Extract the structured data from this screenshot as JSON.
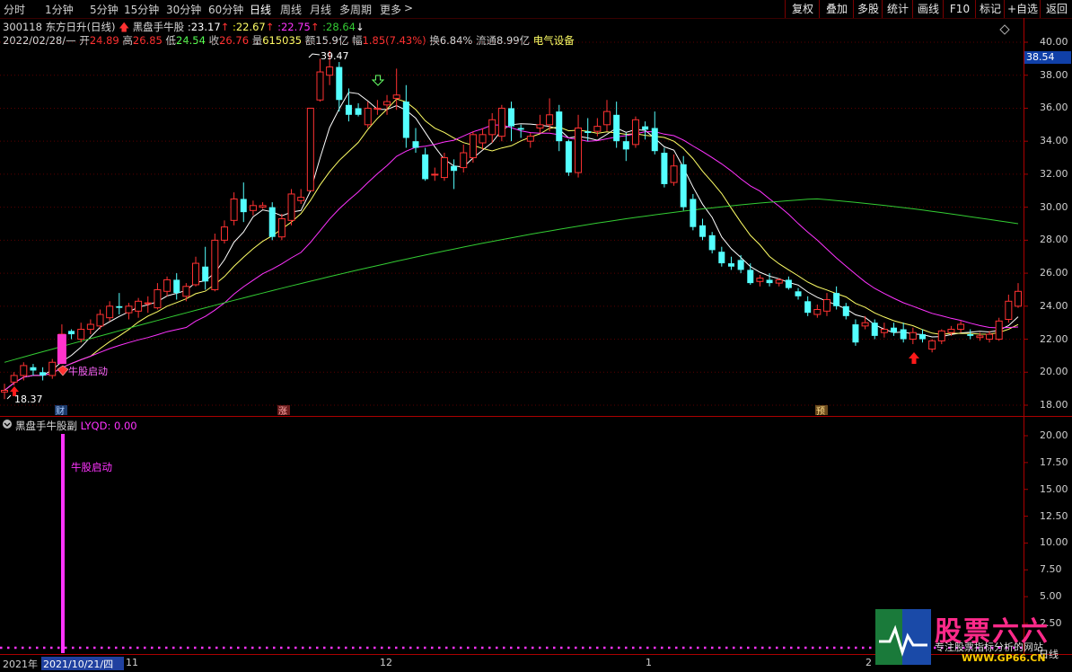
{
  "toolbar": {
    "periods": [
      "分时",
      "1分钟",
      "5分钟",
      "15分钟",
      "30分钟",
      "60分钟",
      "日线",
      "周线",
      "月线",
      "多周期",
      "更多"
    ],
    "active": "日线",
    "right_buttons": [
      "复权",
      "叠加",
      "多股",
      "统计",
      "画线",
      "F10",
      "标记",
      "+自选",
      "返回"
    ]
  },
  "header": {
    "code": "300118",
    "name": "东方日升",
    "period": "(日线)",
    "indicator": "黑盘手牛股",
    "v1": "23.17",
    "v2": "22.67",
    "v3": "22.75",
    "v4": "28.64"
  },
  "quote": {
    "date": "2022/02/28/—",
    "open_label": "开",
    "open": "24.89",
    "high_label": "高",
    "high": "26.85",
    "low_label": "低",
    "low": "24.54",
    "close_label": "收",
    "close": "26.76",
    "vol_label": "量",
    "vol": "615035",
    "amt_label": "额",
    "amt": "15.9亿",
    "chg_label": "幅",
    "chg": "1.85(7.43%)",
    "turn_label": "换",
    "turn": "6.84%",
    "float_label": "流通",
    "float": "8.99亿",
    "sector": "电气设备"
  },
  "main_axis": {
    "ticks": [
      "40.00",
      "38.00",
      "36.00",
      "34.00",
      "32.00",
      "30.00",
      "28.00",
      "26.00",
      "24.00",
      "22.00",
      "20.00",
      "18.00"
    ],
    "current_price": "38.54"
  },
  "annotations": {
    "peak": "39.47",
    "low": "18.37",
    "launch": "牛股启动",
    "event_cai": "财",
    "event_zhang": "涨",
    "event_yu": "预"
  },
  "sub": {
    "title": "黑盘手牛股副",
    "param_label": "LYQD: ",
    "param_value": "0.00",
    "ticks": [
      "20.00",
      "17.50",
      "15.00",
      "12.50",
      "10.00",
      "7.50",
      "5.00",
      "2.50"
    ],
    "signal_label": "牛股启动"
  },
  "date_bar": {
    "year": "2021年",
    "selected": "2021/10/21/四",
    "months": [
      "11",
      "12",
      "1",
      "2"
    ],
    "right_label": "日线"
  },
  "watermark": {
    "brand": "股票六六",
    "slogan": "专注股票指标分析的网站",
    "url": "WWW.GP66.CN"
  },
  "colors": {
    "up": "#ff3232",
    "down": "#54ffff",
    "ma5": "#ffffff",
    "ma10": "#ffff66",
    "ma20": "#ff33ff",
    "ma60": "#33cc33",
    "signal": "#ff33ff"
  }
}
